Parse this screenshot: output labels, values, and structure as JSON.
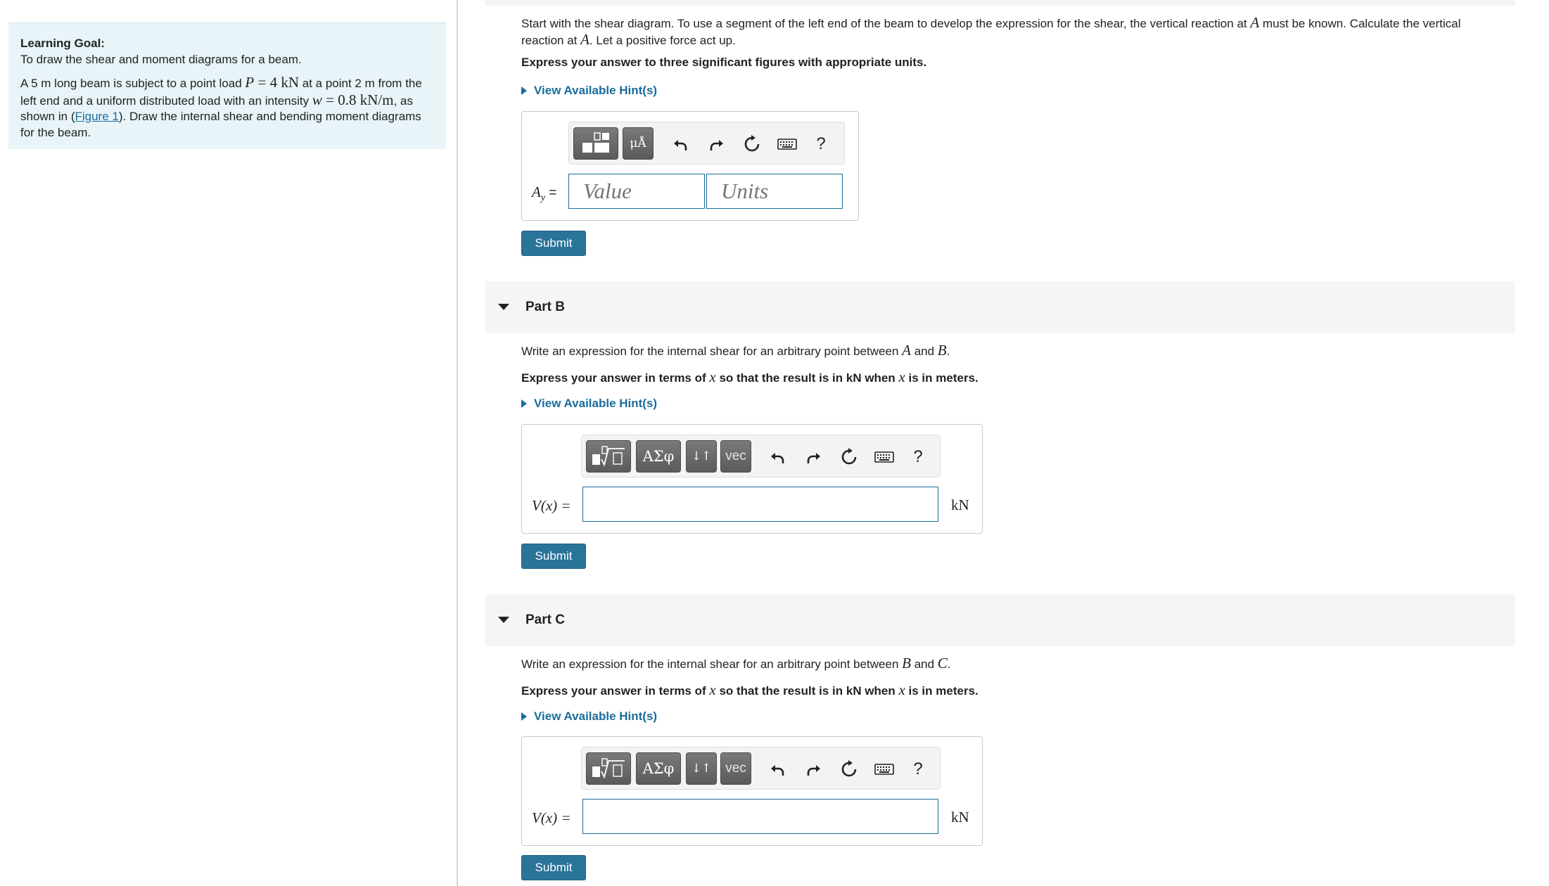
{
  "learning_goal": {
    "title": "Learning Goal:",
    "subtitle": "To draw the shear and moment diagrams for a beam.",
    "desc_part1": "A 5 m long beam is subject to a point load ",
    "P_sym": "P",
    "P_eq": " = 4 kN",
    "desc_part2": " at a point 2 m from the left end and a uniform distributed load with an intensity ",
    "w_sym": "w",
    "w_eq": " = 0.8 kN/m",
    "desc_part3": ", as shown in (",
    "figure_link": "Figure 1",
    "desc_part4": "). Draw the internal shear and bending moment diagrams for the beam."
  },
  "part_a": {
    "prompt_1": "Start with the shear diagram. To use a segment of the left end of the beam to develop the expression for the shear, the vertical reaction at ",
    "sym_A1": "A",
    "prompt_2": " must be known. Calculate the vertical reaction at ",
    "sym_A2": "A",
    "prompt_3": ". Let a positive force act up.",
    "instruction": "Express your answer to three significant figures with appropriate units.",
    "hint_label": "View Available Hint(s)",
    "toolbar": {
      "units_label": "μÅ",
      "help": "?"
    },
    "input_label_sym": "A",
    "input_label_sub": "y",
    "input_label_eq": " =",
    "value_placeholder": "Value",
    "units_placeholder": "Units",
    "submit_label": "Submit"
  },
  "part_b": {
    "title": "Part B",
    "prompt_1": "Write an expression for the internal shear for an arbitrary point between ",
    "sym_1": "A",
    "prompt_and": " and ",
    "sym_2": "B",
    "prompt_end": ".",
    "instr_1": "Express your answer in terms of ",
    "instr_x1": "x",
    "instr_2": " so that the result is in kN when ",
    "instr_x2": "x",
    "instr_3": " is in meters.",
    "hint_label": "View Available Hint(s)",
    "toolbar": {
      "greek": "ΑΣφ",
      "arrows": "↓↑",
      "vec": "vec",
      "help": "?"
    },
    "input_label": "V(x) =",
    "unit": "kN",
    "submit_label": "Submit"
  },
  "part_c": {
    "title": "Part C",
    "prompt_1": "Write an expression for the internal shear for an arbitrary point between ",
    "sym_1": "B",
    "prompt_and": " and ",
    "sym_2": "C",
    "prompt_end": ".",
    "instr_1": "Express your answer in terms of ",
    "instr_x1": "x",
    "instr_2": " so that the result is in kN when ",
    "instr_x2": "x",
    "instr_3": " is in meters.",
    "hint_label": "View Available Hint(s)",
    "toolbar": {
      "greek": "ΑΣφ",
      "arrows": "↓↑",
      "vec": "vec",
      "help": "?"
    },
    "input_label": "V(x) =",
    "unit": "kN",
    "submit_label": "Submit"
  },
  "colors": {
    "accent": "#1a6d9c",
    "submit": "#2a7399",
    "goal_bg": "#e8f4f8"
  }
}
